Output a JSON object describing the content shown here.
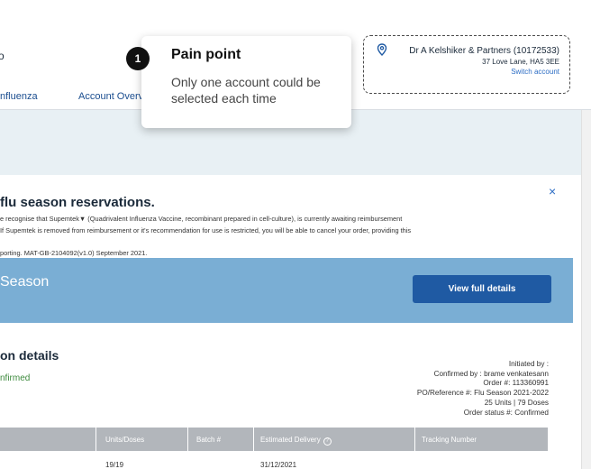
{
  "header": {
    "left_fragment": "o",
    "nav": [
      {
        "label": "nfluenza"
      },
      {
        "label": "Account Overv"
      }
    ]
  },
  "account": {
    "name": "Dr A Kelshiker & Partners (10172533)",
    "address": "37 Love Lane, HA5 3EE",
    "switch_label": "Switch account",
    "icon": "location-pin-icon"
  },
  "callout": {
    "number": "1",
    "title": "Pain point",
    "body": "Only one account could be selected each time"
  },
  "notice": {
    "title": "flu season reservations.",
    "close_symbol": "×",
    "lines": [
      "e recognise that Supemtek▼ (Quadrivalent Influenza Vaccine, recombinant prepared in cell-culture), is currently awaiting reimbursement",
      "If Supemtek is removed from reimbursement or it's recommendation for use is restricted, you will be able to cancel your order, providing this",
      "porting. MAT-GB-2104092(v1.0) September 2021."
    ]
  },
  "season": {
    "title": "Season",
    "view_button": "View full details"
  },
  "details": {
    "title": "on details",
    "status": "nfirmed",
    "meta": [
      "Initiated by :",
      "Confirmed by : brame venkatesann",
      "Order #: 113360991",
      "PO/Reference #: Flu Season 2021-2022",
      "25 Units | 79 Doses",
      "Order status #: Confirmed"
    ]
  },
  "table": {
    "columns": [
      "Units/Doses",
      "Batch #",
      "Estimated Delivery",
      "Tracking Number"
    ],
    "help_icon": "?",
    "rows": [
      {
        "units": "19/19",
        "batch": "",
        "delivery": "31/12/2021",
        "tracking": ""
      }
    ]
  },
  "colors": {
    "banner": "#7aaed4",
    "button": "#1f5aa3",
    "band": "#e8f0f4",
    "status_green": "#3d8a3d",
    "link_blue": "#2b6cc4"
  }
}
